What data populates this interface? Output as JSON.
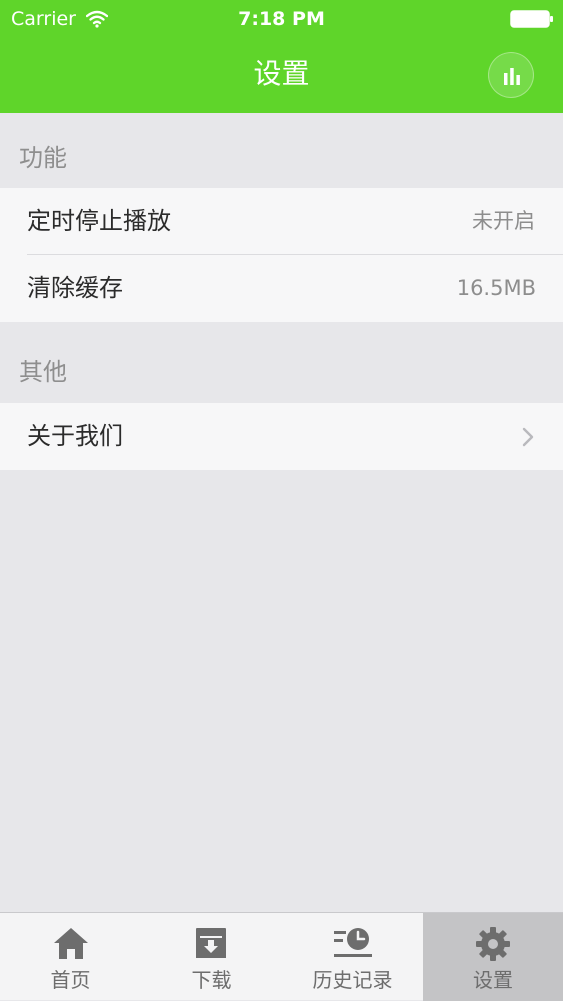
{
  "status_bar": {
    "carrier": "Carrier",
    "time": "7:18 PM"
  },
  "nav": {
    "title": "设置",
    "right_icon": "chart-bars-icon"
  },
  "colors": {
    "accent": "#5fd52a",
    "background": "#e7e7ea",
    "row_background": "#f7f7f8",
    "secondary_text": "#8d8d8d",
    "tab_active_background": "#c4c4c6"
  },
  "sections": [
    {
      "header": "功能",
      "rows": [
        {
          "label": "定时停止播放",
          "value": "未开启"
        },
        {
          "label": "清除缓存",
          "value": "16.5MB"
        }
      ]
    },
    {
      "header": "其他",
      "rows": [
        {
          "label": "关于我们",
          "accessory": "chevron-right-icon"
        }
      ]
    }
  ],
  "tabbar": {
    "selected": "设置",
    "items": [
      {
        "label": "首页",
        "icon": "home-icon"
      },
      {
        "label": "下载",
        "icon": "download-box-icon"
      },
      {
        "label": "历史记录",
        "icon": "history-clock-icon"
      },
      {
        "label": "设置",
        "icon": "gear-icon"
      }
    ]
  }
}
